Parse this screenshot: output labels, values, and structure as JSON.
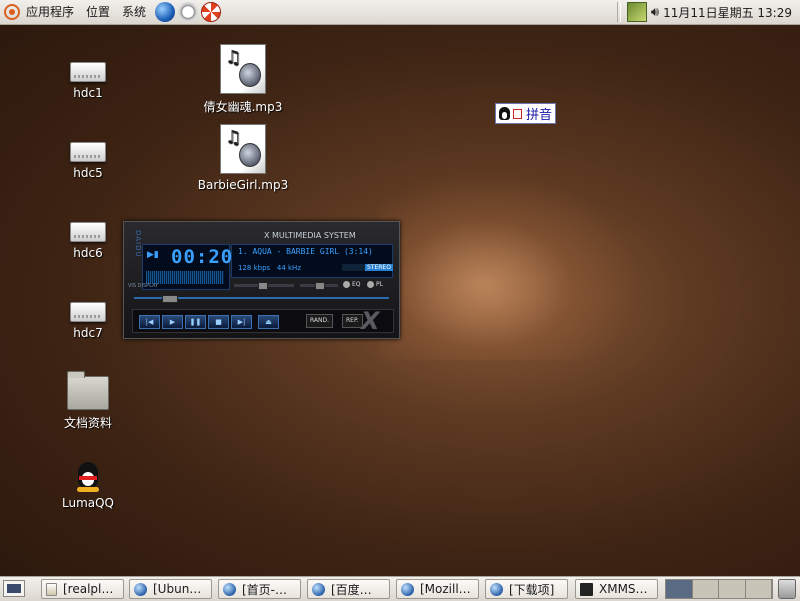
{
  "top_panel": {
    "menus": [
      "应用程序",
      "位置",
      "系统"
    ],
    "clock": "11月11日星期五  13:29"
  },
  "desktop_icons": [
    {
      "label": "hdc1",
      "icon": "drive-icon"
    },
    {
      "label": "hdc5",
      "icon": "drive-icon"
    },
    {
      "label": "hdc6",
      "icon": "drive-icon"
    },
    {
      "label": "hdc7",
      "icon": "drive-icon"
    },
    {
      "label": "文档资料",
      "icon": "folder-icon"
    },
    {
      "label": "LumaQQ",
      "icon": "penguin-icon"
    },
    {
      "label": "倩女幽魂.mp3",
      "icon": "audio-file-icon"
    },
    {
      "label": "BarbieGirl.mp3",
      "icon": "audio-file-icon"
    }
  ],
  "ime": {
    "label": "拼音"
  },
  "xmms": {
    "title": "X MULTIMEDIA SYSTEM",
    "time": "00:20",
    "song": "1. AQUA - BARBIE GIRL (3:14)",
    "bitrate": "128 kbps",
    "samplerate": "44 kHz",
    "mono_label": "MONO",
    "stereo_label": "STEREO",
    "eq_label": "EQ",
    "pl_label": "PL",
    "viz_label": "VIS DISPLAY",
    "side_label": "DAIDU",
    "shuffle_label": "RAND.",
    "repeat_label": "REP.",
    "controls": [
      "previous",
      "play",
      "pause",
      "stop",
      "next",
      "eject"
    ]
  },
  "taskbar": {
    "tasks": [
      {
        "label": "[realpl…",
        "icon": "document-icon"
      },
      {
        "label": "[Ubun…",
        "icon": "browser-icon"
      },
      {
        "label": "[首页-…",
        "icon": "browser-icon"
      },
      {
        "label": "[百度…",
        "icon": "browser-icon"
      },
      {
        "label": "[Mozill…",
        "icon": "browser-icon"
      },
      {
        "label": "[下载项]",
        "icon": "browser-icon"
      },
      {
        "label": "XMMS…",
        "icon": "xmms-icon"
      }
    ],
    "workspaces": 4,
    "active_workspace": 1
  },
  "colors": {
    "accent_blue": "#3aa0ff",
    "panel_bg": "#e6e2da",
    "desktop_brown": "#4a2c18"
  }
}
